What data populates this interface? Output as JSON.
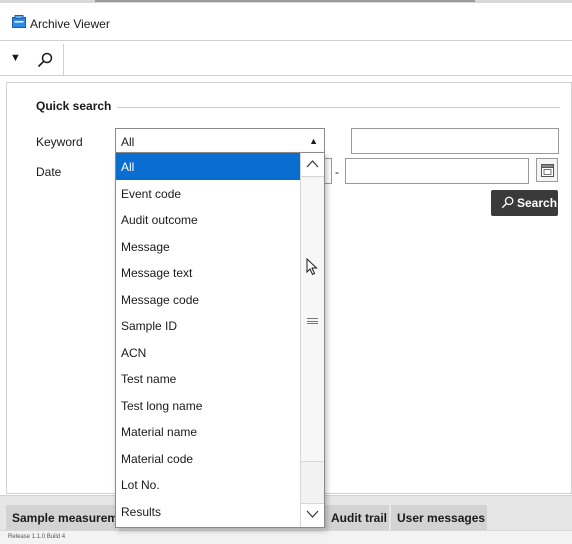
{
  "window": {
    "title": "Archive Viewer"
  },
  "quick_search": {
    "legend": "Quick search",
    "keyword_label": "Keyword",
    "keyword_selected": "All",
    "date_label": "Date",
    "date_separator": "-",
    "search_button": "Search"
  },
  "dropdown": {
    "options": [
      "All",
      "Event code",
      "Audit outcome",
      "Message",
      "Message text",
      "Message code",
      "Sample ID",
      "ACN",
      "Test name",
      "Test long name",
      "Material name",
      "Material code",
      "Lot No.",
      "Results"
    ],
    "selected_index": 0
  },
  "tabs": {
    "sample": "Sample measurem",
    "audit": "Audit trail",
    "user": "User messages"
  },
  "status": {
    "release": "Release 1.1.0 Build 4"
  },
  "colors": {
    "selection": "#0a6ed1",
    "search_button": "#3a3a3a"
  }
}
